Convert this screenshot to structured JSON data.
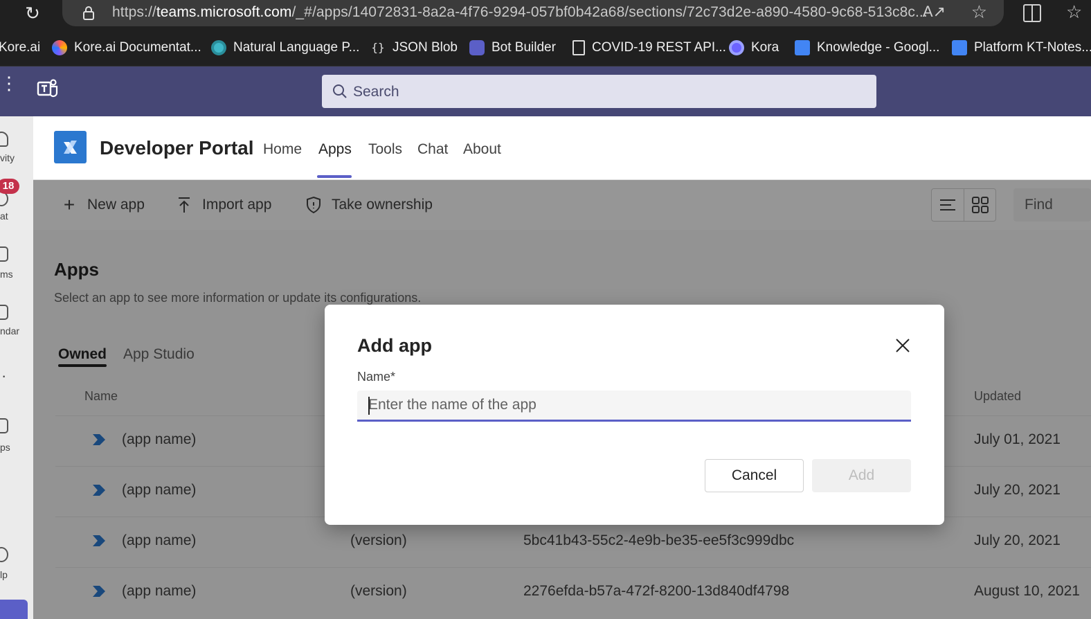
{
  "browser": {
    "url_prefix": "https://",
    "url_host": "teams.microsoft.com",
    "url_rest": "/_#/apps/14072831-8a2a-4f76-9294-057bf0b42a68/sections/72c73d2e-a890-4580-9c68-513c8c...",
    "bookmarks": [
      {
        "label": "Kore.ai",
        "color": "#202020"
      },
      {
        "label": "Kore.ai Documentat...",
        "color": "#7b5cff"
      },
      {
        "label": "Natural Language P...",
        "color": "#3fb8c8"
      },
      {
        "label": "JSON Blob",
        "color": "#9e9e9e"
      },
      {
        "label": "Bot Builder",
        "color": "#5b5fc7"
      },
      {
        "label": "COVID-19 REST API...",
        "color": "#dddddd"
      },
      {
        "label": "Kora",
        "color": "#6c63ff"
      },
      {
        "label": "Knowledge - Googl...",
        "color": "#4285f4"
      },
      {
        "label": "Platform KT-Notes...",
        "color": "#4285f4"
      }
    ]
  },
  "teams": {
    "search_placeholder": "Search"
  },
  "rail": {
    "items": [
      "vity",
      "at",
      "ms",
      "ndar",
      "ps",
      "lp"
    ],
    "badge": "18"
  },
  "header": {
    "title": "Developer Portal",
    "tabs": [
      "Home",
      "Apps",
      "Tools",
      "Chat",
      "About"
    ],
    "active_tab": "Apps"
  },
  "toolbar": {
    "new_app": "New app",
    "import_app": "Import app",
    "take_ownership": "Take ownership",
    "find_placeholder": "Find"
  },
  "main": {
    "title": "Apps",
    "subtitle": "Select an app to see more information or update its configurations.",
    "tabs": [
      "Owned",
      "App Studio"
    ],
    "columns": {
      "name": "Name",
      "updated": "Updated"
    },
    "rows": [
      {
        "name": "(app name)",
        "version": "",
        "id": "",
        "updated": "July 01, 2021"
      },
      {
        "name": "(app name)",
        "version": "",
        "id": "",
        "updated": "July 20, 2021"
      },
      {
        "name": "(app name)",
        "version": "(version)",
        "id": "5bc41b43-55c2-4e9b-be35-ee5f3c999dbc",
        "updated": "July 20, 2021"
      },
      {
        "name": "(app name)",
        "version": "(version)",
        "id": "2276efda-b57a-472f-8200-13d840df4798",
        "updated": "August 10, 2021"
      }
    ]
  },
  "dialog": {
    "title": "Add app",
    "name_label": "Name*",
    "name_placeholder": "Enter the name of the app",
    "name_value": "",
    "cancel_label": "Cancel",
    "add_label": "Add"
  },
  "colors": {
    "teams_purple": "#464775",
    "accent": "#5b5fc7",
    "badge": "#c4314b"
  }
}
